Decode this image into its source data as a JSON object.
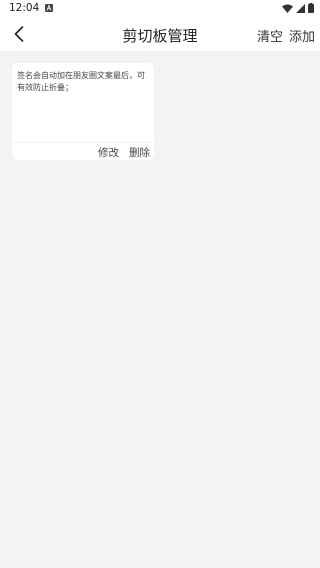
{
  "status_bar": {
    "time": "12:04"
  },
  "toolbar": {
    "title": "剪切板管理",
    "clear_label": "清空",
    "add_label": "添加"
  },
  "clips": [
    {
      "text": "签名会自动加在朋友圈文案最后，可有效防止折叠；",
      "edit_label": "修改",
      "delete_label": "删除"
    }
  ],
  "colors": {
    "background": "#f2f3f5",
    "card": "#ffffff",
    "text": "#222222"
  },
  "icons": [
    "notification-a-icon",
    "wifi-icon",
    "cellular-signal-icon",
    "battery-icon",
    "back-arrow-icon"
  ]
}
